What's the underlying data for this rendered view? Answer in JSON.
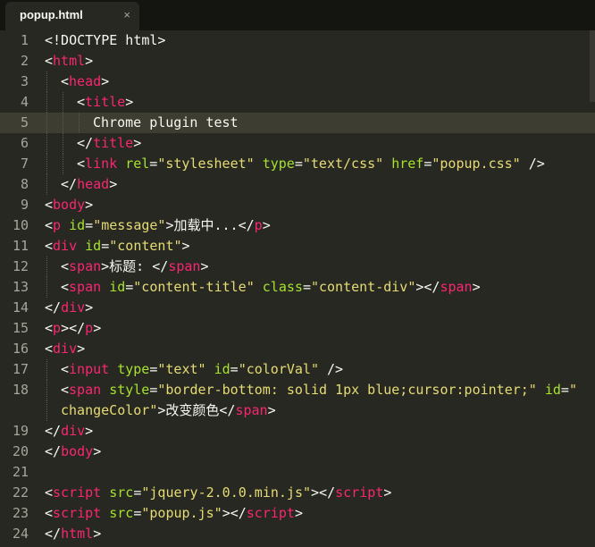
{
  "tab": {
    "title": "popup.html",
    "close_label": "×"
  },
  "colors": {
    "background": "#272822",
    "tag": "#f92672",
    "attribute": "#a6e22e",
    "string": "#e6db74",
    "text": "#f8f8f2"
  },
  "current_line": 5,
  "lines": [
    {
      "num": "1",
      "indent": 0,
      "tokens": [
        [
          "p",
          "<!DOCTYPE html>"
        ]
      ]
    },
    {
      "num": "2",
      "indent": 0,
      "tokens": [
        [
          "p",
          "<"
        ],
        [
          "t",
          "html"
        ],
        [
          "p",
          ">"
        ]
      ]
    },
    {
      "num": "3",
      "indent": 1,
      "tokens": [
        [
          "p",
          "<"
        ],
        [
          "t",
          "head"
        ],
        [
          "p",
          ">"
        ]
      ]
    },
    {
      "num": "4",
      "indent": 2,
      "tokens": [
        [
          "p",
          "<"
        ],
        [
          "t",
          "title"
        ],
        [
          "p",
          ">"
        ]
      ]
    },
    {
      "num": "5",
      "indent": 3,
      "tokens": [
        [
          "p",
          "Chrome plugin test"
        ]
      ]
    },
    {
      "num": "6",
      "indent": 2,
      "tokens": [
        [
          "p",
          "</"
        ],
        [
          "t",
          "title"
        ],
        [
          "p",
          ">"
        ]
      ]
    },
    {
      "num": "7",
      "indent": 2,
      "tokens": [
        [
          "p",
          "<"
        ],
        [
          "t",
          "link"
        ],
        [
          "p",
          " "
        ],
        [
          "a",
          "rel"
        ],
        [
          "p",
          "="
        ],
        [
          "s",
          "\"stylesheet\""
        ],
        [
          "p",
          " "
        ],
        [
          "a",
          "type"
        ],
        [
          "p",
          "="
        ],
        [
          "s",
          "\"text/css\""
        ],
        [
          "p",
          " "
        ],
        [
          "a",
          "href"
        ],
        [
          "p",
          "="
        ],
        [
          "s",
          "\"popup.css\""
        ],
        [
          "p",
          " />"
        ]
      ]
    },
    {
      "num": "8",
      "indent": 1,
      "tokens": [
        [
          "p",
          "</"
        ],
        [
          "t",
          "head"
        ],
        [
          "p",
          ">"
        ]
      ]
    },
    {
      "num": "9",
      "indent": 0,
      "tokens": [
        [
          "p",
          "<"
        ],
        [
          "t",
          "body"
        ],
        [
          "p",
          ">"
        ]
      ]
    },
    {
      "num": "10",
      "indent": 0,
      "tokens": [
        [
          "p",
          "<"
        ],
        [
          "t",
          "p"
        ],
        [
          "p",
          " "
        ],
        [
          "a",
          "id"
        ],
        [
          "p",
          "="
        ],
        [
          "s",
          "\"message\""
        ],
        [
          "p",
          ">加载中...</"
        ],
        [
          "t",
          "p"
        ],
        [
          "p",
          ">"
        ]
      ]
    },
    {
      "num": "11",
      "indent": 0,
      "tokens": [
        [
          "p",
          "<"
        ],
        [
          "t",
          "div"
        ],
        [
          "p",
          " "
        ],
        [
          "a",
          "id"
        ],
        [
          "p",
          "="
        ],
        [
          "s",
          "\"content\""
        ],
        [
          "p",
          ">"
        ]
      ]
    },
    {
      "num": "12",
      "indent": 1,
      "tokens": [
        [
          "p",
          "<"
        ],
        [
          "t",
          "span"
        ],
        [
          "p",
          ">标题: </"
        ],
        [
          "t",
          "span"
        ],
        [
          "p",
          ">"
        ]
      ]
    },
    {
      "num": "13",
      "indent": 1,
      "tokens": [
        [
          "p",
          "<"
        ],
        [
          "t",
          "span"
        ],
        [
          "p",
          " "
        ],
        [
          "a",
          "id"
        ],
        [
          "p",
          "="
        ],
        [
          "s",
          "\"content-title\""
        ],
        [
          "p",
          " "
        ],
        [
          "a",
          "class"
        ],
        [
          "p",
          "="
        ],
        [
          "s",
          "\"content-div\""
        ],
        [
          "p",
          "></"
        ],
        [
          "t",
          "span"
        ],
        [
          "p",
          ">"
        ]
      ]
    },
    {
      "num": "14",
      "indent": 0,
      "tokens": [
        [
          "p",
          "</"
        ],
        [
          "t",
          "div"
        ],
        [
          "p",
          ">"
        ]
      ]
    },
    {
      "num": "15",
      "indent": 0,
      "tokens": [
        [
          "p",
          "<"
        ],
        [
          "t",
          "p"
        ],
        [
          "p",
          "></"
        ],
        [
          "t",
          "p"
        ],
        [
          "p",
          ">"
        ]
      ]
    },
    {
      "num": "16",
      "indent": 0,
      "tokens": [
        [
          "p",
          "<"
        ],
        [
          "t",
          "div"
        ],
        [
          "p",
          ">"
        ]
      ]
    },
    {
      "num": "17",
      "indent": 1,
      "tokens": [
        [
          "p",
          "<"
        ],
        [
          "t",
          "input"
        ],
        [
          "p",
          " "
        ],
        [
          "a",
          "type"
        ],
        [
          "p",
          "="
        ],
        [
          "s",
          "\"text\""
        ],
        [
          "p",
          " "
        ],
        [
          "a",
          "id"
        ],
        [
          "p",
          "="
        ],
        [
          "s",
          "\"colorVal\""
        ],
        [
          "p",
          " />"
        ]
      ]
    },
    {
      "num": "18",
      "indent": 1,
      "tokens": [
        [
          "p",
          "<"
        ],
        [
          "t",
          "span"
        ],
        [
          "p",
          " "
        ],
        [
          "a",
          "style"
        ],
        [
          "p",
          "="
        ],
        [
          "s",
          "\"border-bottom: solid 1px blue;cursor:pointer;\""
        ],
        [
          "p",
          " "
        ],
        [
          "a",
          "id"
        ],
        [
          "p",
          "="
        ],
        [
          "s",
          "\""
        ]
      ]
    },
    {
      "num": "",
      "indent": 1,
      "tokens": [
        [
          "s",
          "changeColor\""
        ],
        [
          "p",
          ">改变颜色</"
        ],
        [
          "t",
          "span"
        ],
        [
          "p",
          ">"
        ]
      ]
    },
    {
      "num": "19",
      "indent": 0,
      "tokens": [
        [
          "p",
          "</"
        ],
        [
          "t",
          "div"
        ],
        [
          "p",
          ">"
        ]
      ]
    },
    {
      "num": "20",
      "indent": 0,
      "tokens": [
        [
          "p",
          "</"
        ],
        [
          "t",
          "body"
        ],
        [
          "p",
          ">"
        ]
      ]
    },
    {
      "num": "21",
      "indent": 0,
      "tokens": []
    },
    {
      "num": "22",
      "indent": 0,
      "tokens": [
        [
          "p",
          "<"
        ],
        [
          "t",
          "script"
        ],
        [
          "p",
          " "
        ],
        [
          "a",
          "src"
        ],
        [
          "p",
          "="
        ],
        [
          "s",
          "\"jquery-2.0.0.min.js\""
        ],
        [
          "p",
          "></"
        ],
        [
          "t",
          "script"
        ],
        [
          "p",
          ">"
        ]
      ]
    },
    {
      "num": "23",
      "indent": 0,
      "tokens": [
        [
          "p",
          "<"
        ],
        [
          "t",
          "script"
        ],
        [
          "p",
          " "
        ],
        [
          "a",
          "src"
        ],
        [
          "p",
          "="
        ],
        [
          "s",
          "\"popup.js\""
        ],
        [
          "p",
          "></"
        ],
        [
          "t",
          "script"
        ],
        [
          "p",
          ">"
        ]
      ]
    },
    {
      "num": "24",
      "indent": 0,
      "tokens": [
        [
          "p",
          "</"
        ],
        [
          "t",
          "html"
        ],
        [
          "p",
          ">"
        ]
      ]
    }
  ]
}
